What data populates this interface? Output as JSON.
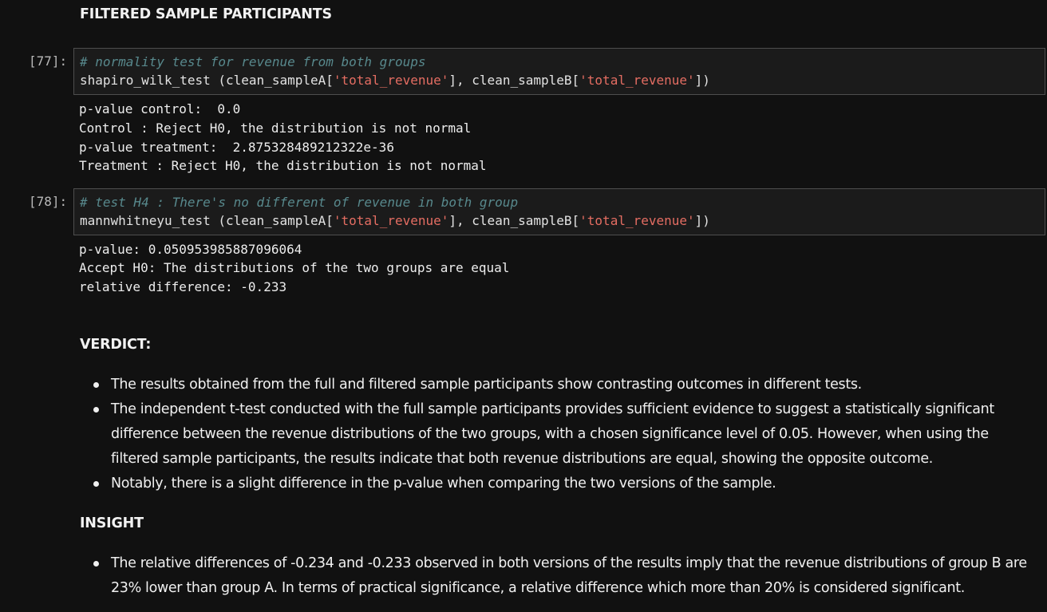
{
  "section_title": "FILTERED SAMPLE PARTICIPANTS",
  "cells": [
    {
      "prompt": "[77]:",
      "comment": "# normality test for revenue from both groups",
      "code": {
        "fn": "shapiro_wilk_test (clean_sampleA[",
        "arg1": "'total_revenue'",
        "mid": "], clean_sampleB[",
        "arg2": "'total_revenue'",
        "end": "])"
      },
      "output": [
        "p-value control:  0.0",
        "Control : Reject H0, the distribution is not normal",
        "p-value treatment:  2.875328489212322e-36",
        "Treatment : Reject H0, the distribution is not normal"
      ]
    },
    {
      "prompt": "[78]:",
      "comment": "# test H4 : There's no different of revenue in both group",
      "code": {
        "fn": "mannwhitneyu_test (clean_sampleA[",
        "arg1": "'total_revenue'",
        "mid": "], clean_sampleB[",
        "arg2": "'total_revenue'",
        "end": "])"
      },
      "output": [
        "p-value: 0.050953985887096064",
        "Accept H0: The distributions of the two groups are equal",
        "relative difference: -0.233"
      ]
    }
  ],
  "verdict": {
    "title": "VERDICT:",
    "items": [
      "The results obtained from the full and filtered sample participants show contrasting outcomes in different tests.",
      "The independent t-test conducted with the full sample participants provides sufficient evidence to suggest a statistically significant difference between the revenue distributions of the two groups, with a chosen significance level of 0.05. However, when using the filtered sample participants, the results indicate that both revenue distributions are equal, showing the opposite outcome.",
      "Notably, there is a slight difference in the p-value when comparing the two versions of the sample."
    ]
  },
  "insight": {
    "title": "INSIGHT",
    "items": [
      "The relative differences of -0.234 and -0.233 observed in both versions of the results imply that the revenue distributions of group B are 23% lower than group A. In terms of practical significance, a relative difference which more than 20% is considered significant."
    ]
  }
}
